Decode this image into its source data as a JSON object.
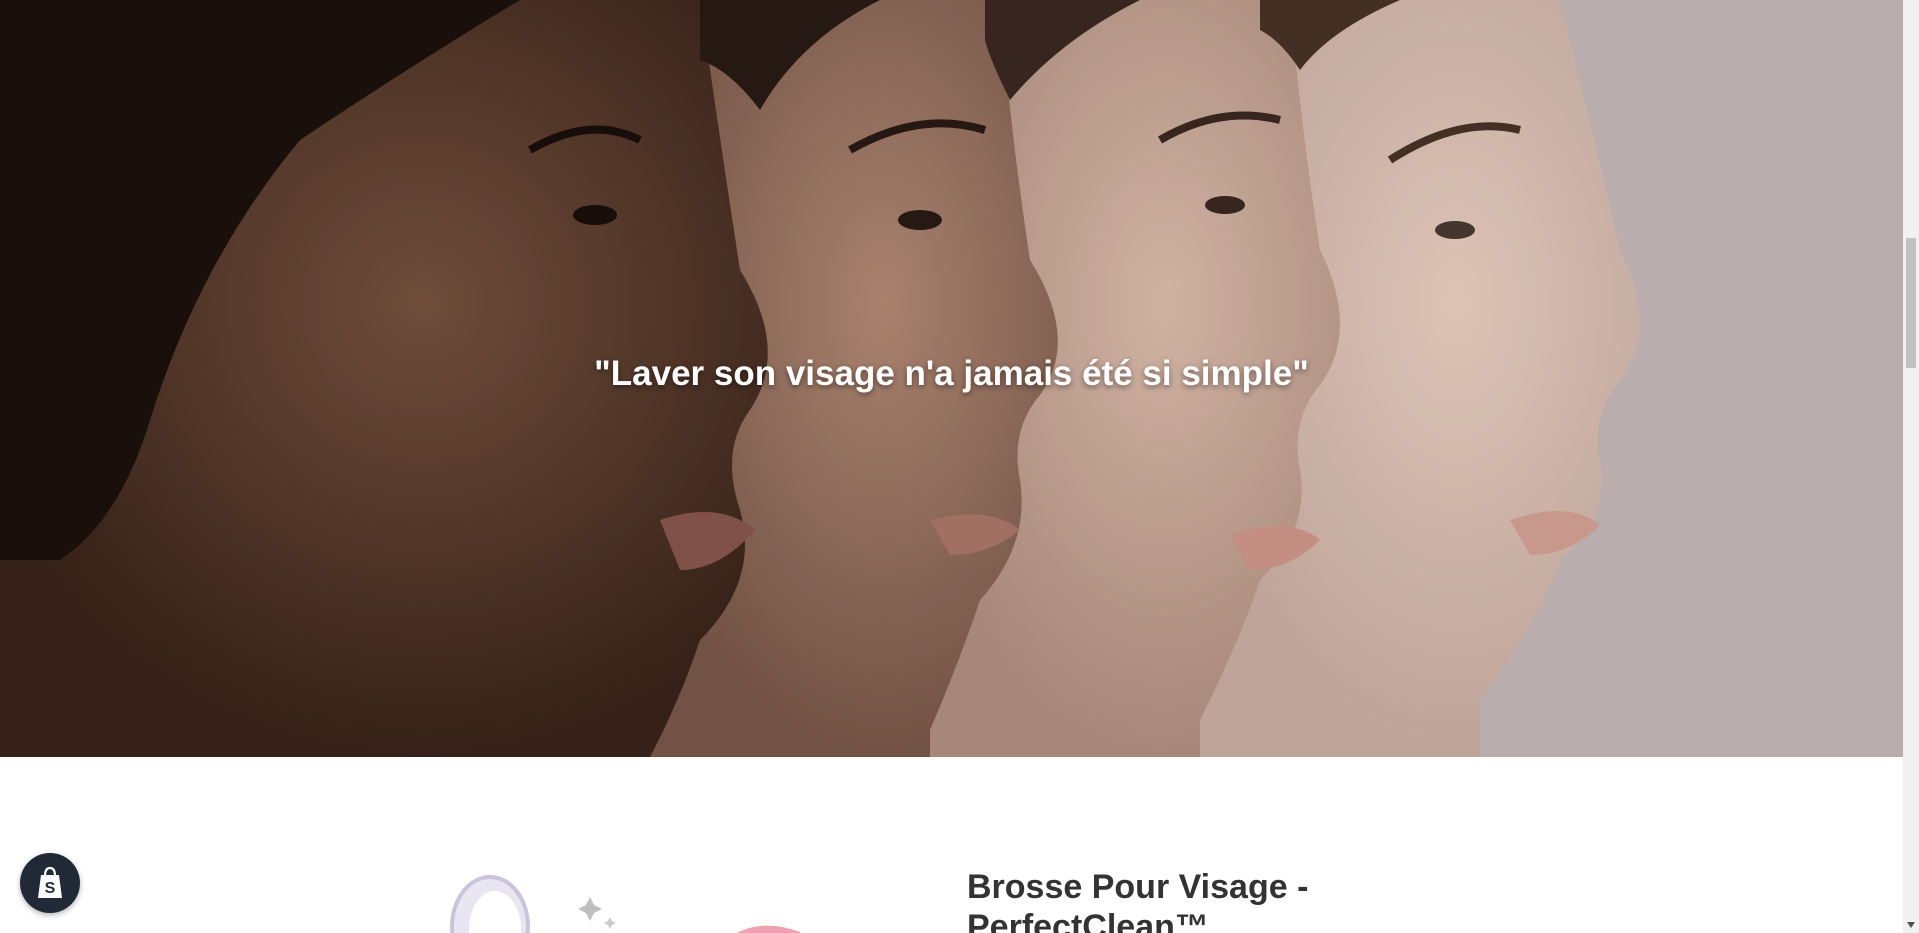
{
  "hero": {
    "quote": "\"Laver son visage n'a jamais été si simple\""
  },
  "product": {
    "title": "Brosse Pour Visage - PerfectClean™"
  },
  "badge": {
    "icon": "shopify-bag-icon",
    "color": "#1f2a36"
  },
  "colors": {
    "text": "#333333",
    "hero_text": "#ffffff"
  }
}
